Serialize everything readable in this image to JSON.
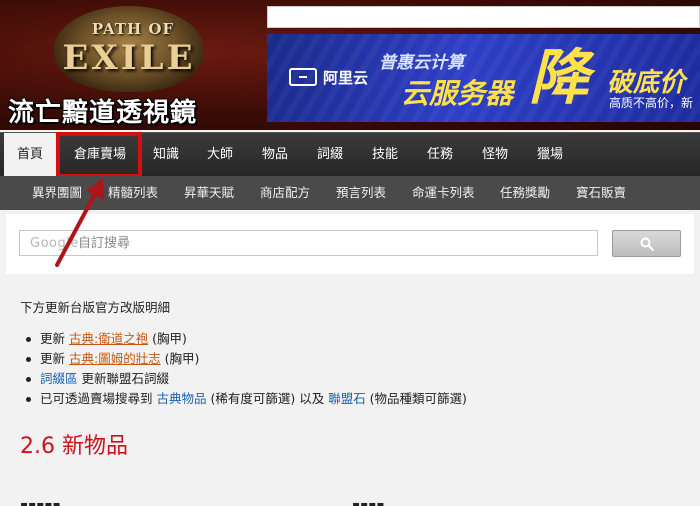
{
  "header": {
    "logo_line1": "PATH OF",
    "logo_line2": "EXILE",
    "site_title": "流亡黯道透視鏡"
  },
  "ad": {
    "logo_text": "阿里云",
    "line1": "普惠云计算",
    "line2": "云服务器",
    "big": "降",
    "line3": "破底价",
    "line4": "高质不高价，新"
  },
  "nav": {
    "items": [
      {
        "label": "首頁",
        "active": true
      },
      {
        "label": "倉庫賣場"
      },
      {
        "label": "知識"
      },
      {
        "label": "大師"
      },
      {
        "label": "物品"
      },
      {
        "label": "詞綴"
      },
      {
        "label": "技能"
      },
      {
        "label": "任務"
      },
      {
        "label": "怪物"
      },
      {
        "label": "獵場"
      }
    ]
  },
  "subnav": {
    "items": [
      {
        "label": "異界團圖"
      },
      {
        "label": "精髓列表"
      },
      {
        "label": "昇華天賦"
      },
      {
        "label": "商店配方"
      },
      {
        "label": "預言列表"
      },
      {
        "label": "命運卡列表"
      },
      {
        "label": "任務獎勵"
      },
      {
        "label": "寶石販賣"
      }
    ]
  },
  "search": {
    "brand": "Google",
    "placeholder": "自訂搜尋"
  },
  "content": {
    "intro": "下方更新台版官方改版明細",
    "bullets": [
      {
        "prefix": "更新 ",
        "link": "古典:衛道之袍",
        "suffix": " (胸甲)"
      },
      {
        "prefix": "更新 ",
        "link": "古典:圖姆的壯志",
        "suffix": " (胸甲)"
      },
      {
        "prefix": "",
        "link": "詞綴區",
        "suffix": " 更新聯盟石詞綴"
      },
      {
        "prefix": "已可透過賣場搜尋到 ",
        "link": "古典物品",
        "middle": " (稀有度可篩選) 以及 ",
        "link2": "聯盟石",
        "suffix": " (物品種類可篩選)"
      }
    ],
    "section_title": "2.6 新物品"
  },
  "colors": {
    "highlight": "#d50f0f",
    "title_red": "#c8141a",
    "link_orange": "#c45a12",
    "link_blue": "#1a5fb4"
  }
}
